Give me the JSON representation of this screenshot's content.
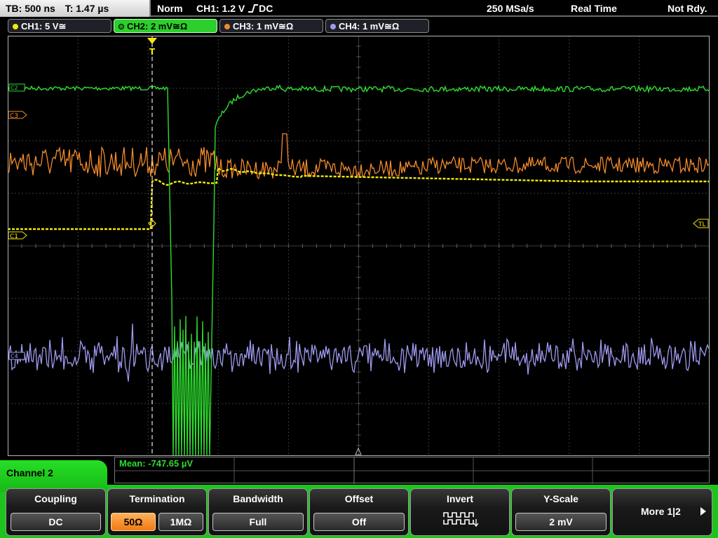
{
  "status": {
    "timebase": "TB: 500 ns",
    "trigger_time": "T: 1.47 µs",
    "mode": "Norm",
    "trigger_info": "CH1: 1.2 V",
    "trigger_slope_icon": "rising-edge-icon",
    "trigger_coupling": "DC",
    "sample_rate": "250 MSa/s",
    "acq_mode": "Real Time",
    "run_state": "Not Rdy."
  },
  "channels": [
    {
      "label": "CH1: 5 V",
      "suffix": "≅",
      "color": "#f2e80f",
      "active": false
    },
    {
      "label": "CH2: 2 mV",
      "suffix": "≅Ω",
      "color": "#2fdc2f",
      "active": true
    },
    {
      "label": "CH3: 1 mV",
      "suffix": "≅Ω",
      "color": "#f28a2b",
      "active": false
    },
    {
      "label": "CH4: 1 mV",
      "suffix": "≅Ω",
      "color": "#9e9af0",
      "active": false
    }
  ],
  "markers": {
    "c1": "C1",
    "c2": "C2",
    "c3": "C3",
    "c4": "C4",
    "trigger_level": "TL",
    "trigger_position": "T"
  },
  "measurement": {
    "label": "Mean: -747.65 µV",
    "color": "#2fdc2f"
  },
  "menu": {
    "title": "Channel 2",
    "coupling": {
      "title": "Coupling",
      "value": "DC"
    },
    "termination": {
      "title": "Termination",
      "options": [
        "50Ω",
        "1MΩ"
      ],
      "selected": "50Ω"
    },
    "bandwidth": {
      "title": "Bandwidth",
      "value": "Full"
    },
    "offset": {
      "title": "Offset",
      "value": "Off"
    },
    "invert": {
      "title": "Invert",
      "icon": "invert-waveform-icon"
    },
    "yscale": {
      "title": "Y-Scale",
      "value": "2 mV"
    },
    "more": {
      "label": "More 1|2",
      "icon": "arrow-right-icon"
    }
  },
  "colors": {
    "ch1": "#f2e80f",
    "ch2": "#2fdc2f",
    "ch3": "#f28a2b",
    "ch4": "#9e9af0",
    "grid": "#4a4a4a",
    "accent_green": "#1ec41e",
    "selected_orange": "#f07a10"
  }
}
